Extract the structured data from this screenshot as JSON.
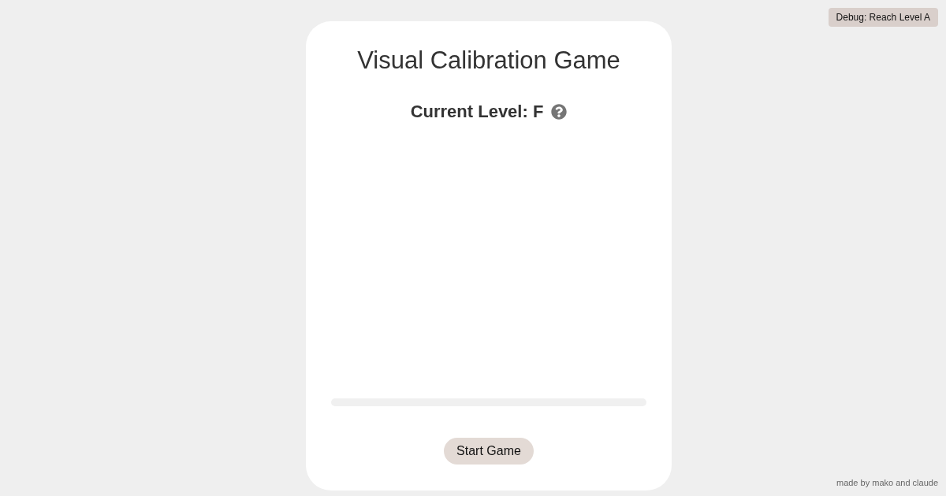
{
  "debug_button": {
    "label": "Debug: Reach Level A"
  },
  "card": {
    "title": "Visual Calibration Game",
    "current_level": "Current Level: F",
    "progress": {
      "level": 0
    },
    "start_button": {
      "label": "Start Game"
    }
  },
  "footer": "made by mako and claude"
}
